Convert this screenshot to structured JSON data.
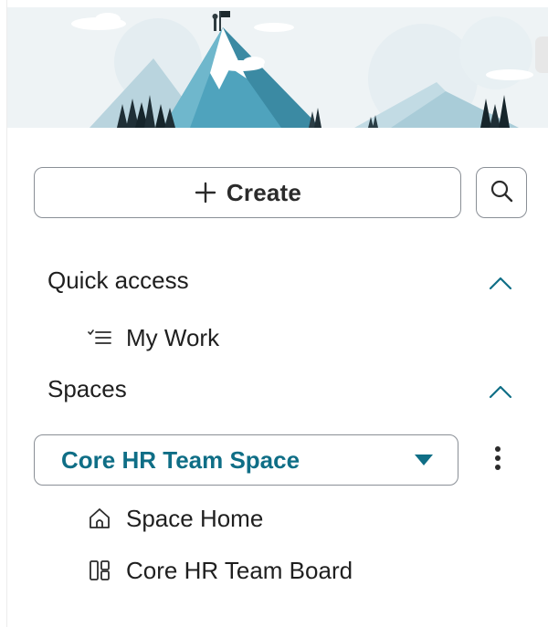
{
  "actions": {
    "create_label": "Create",
    "create_icon": "plus-icon",
    "search_icon": "search-icon"
  },
  "quick_access": {
    "heading": "Quick access",
    "toggle_icon": "chevron-up-icon",
    "items": [
      {
        "label": "My Work",
        "icon": "checklist-icon"
      }
    ]
  },
  "spaces": {
    "heading": "Spaces",
    "toggle_icon": "chevron-up-icon",
    "selected_space": "Core HR Team Space",
    "selector_icon": "caret-down-icon",
    "more_icon": "more-vertical-icon",
    "items": [
      {
        "label": "Space Home",
        "icon": "home-icon"
      },
      {
        "label": "Core HR Team Board",
        "icon": "board-icon"
      }
    ]
  },
  "colors": {
    "accent": "#0f6e86",
    "border": "#8a8f96",
    "text": "#1f1f1f",
    "banner_sky": "#eef3f5",
    "mountain": "#4fa3bd"
  }
}
